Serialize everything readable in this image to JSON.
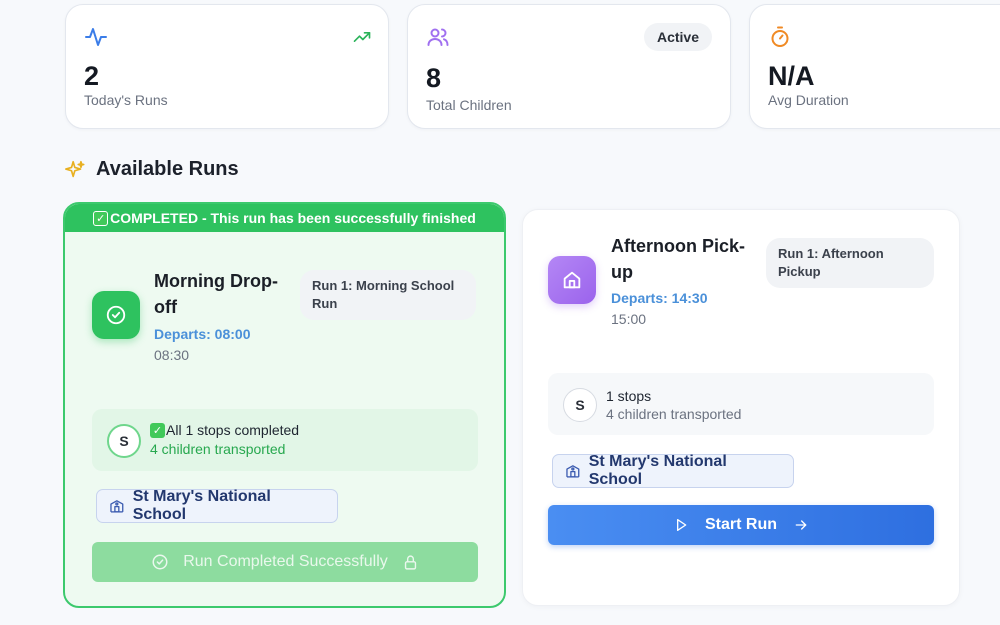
{
  "stats": [
    {
      "icon": "activity-icon",
      "value": "2",
      "label": "Today's Runs",
      "trend_icon": "trending-up-icon"
    },
    {
      "icon": "users-icon",
      "value": "8",
      "label": "Total Children",
      "badge": "Active"
    },
    {
      "icon": "timer-icon",
      "value": "N/A",
      "label": "Avg Duration"
    }
  ],
  "section": {
    "title": "Available Runs",
    "icon": "sparkles-icon"
  },
  "runs": [
    {
      "status": "completed",
      "banner": "COMPLETED - This run has been successfully finished",
      "title_line1": "Morning Drop-",
      "title_line2": "off",
      "departs": "Departs: 08:00",
      "time": "08:30",
      "tag_line1": "Run 1: Morning School",
      "tag_line2": "Run",
      "stop_avatar": "S",
      "stops_text": "All 1 stops completed",
      "children_text": "4 children transported",
      "school": "St Mary's National School",
      "button": "Run Completed Successfully"
    },
    {
      "status": "pending",
      "title_line1": "Afternoon Pick-",
      "title_line2": "up",
      "departs": "Departs: 14:30",
      "time": "15:00",
      "tag_line1": "Run 1: Afternoon",
      "tag_line2": "Pickup",
      "stop_avatar": "S",
      "stops_text": "1 stops",
      "children_text": "4 children transported",
      "school": "St Mary's National School",
      "button": "Start Run"
    }
  ],
  "colors": {
    "accent_green": "#2ec25f",
    "accent_blue": "#3478e6",
    "accent_purple": "#a070f0",
    "orange": "#f08a24"
  }
}
